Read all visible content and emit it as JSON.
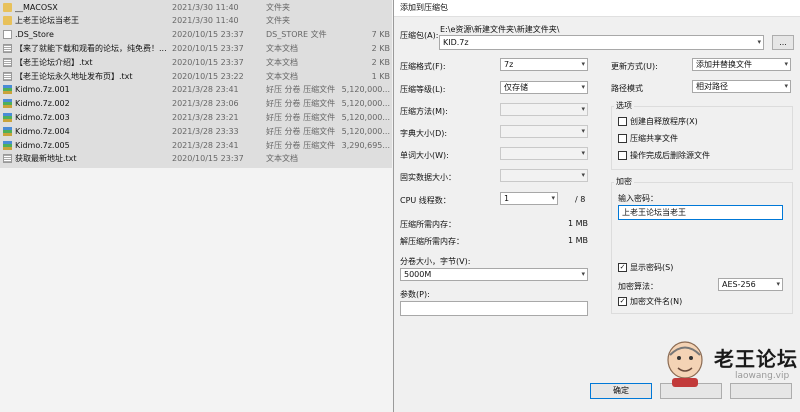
{
  "files": [
    {
      "name": "__MACOSX",
      "date": "2021/3/30 11:40",
      "type": "文件夹",
      "size": "",
      "icon": "folder-icon"
    },
    {
      "name": "上老王论坛当老王",
      "date": "2021/3/30 11:40",
      "type": "文件夹",
      "size": "",
      "icon": "folder-icon"
    },
    {
      "name": ".DS_Store",
      "date": "2020/10/15 23:37",
      "type": "DS_STORE 文件",
      "size": "7 KB",
      "icon": "file-icon"
    },
    {
      "name": "【来了就能下载和观看的论坛，纯免费！...",
      "date": "2020/10/15 23:37",
      "type": "文本文档",
      "size": "2 KB",
      "icon": "text-file-icon"
    },
    {
      "name": "【老王论坛介绍】.txt",
      "date": "2020/10/15 23:37",
      "type": "文本文档",
      "size": "2 KB",
      "icon": "text-file-icon"
    },
    {
      "name": "【老王论坛永久地址发布页】.txt",
      "date": "2020/10/15 23:22",
      "type": "文本文档",
      "size": "1 KB",
      "icon": "text-file-icon"
    },
    {
      "name": "Kidmo.7z.001",
      "date": "2021/3/28 23:41",
      "type": "好压 分卷 压缩文件",
      "size": "5,120,000...",
      "icon": "archive-icon"
    },
    {
      "name": "Kidmo.7z.002",
      "date": "2021/3/28 23:06",
      "type": "好压 分卷 压缩文件",
      "size": "5,120,000...",
      "icon": "archive-icon"
    },
    {
      "name": "Kidmo.7z.003",
      "date": "2021/3/28 23:21",
      "type": "好压 分卷 压缩文件",
      "size": "5,120,000...",
      "icon": "archive-icon"
    },
    {
      "name": "Kidmo.7z.004",
      "date": "2021/3/28 23:33",
      "type": "好压 分卷 压缩文件",
      "size": "5,120,000...",
      "icon": "archive-icon"
    },
    {
      "name": "Kidmo.7z.005",
      "date": "2021/3/28 23:41",
      "type": "好压 分卷 压缩文件",
      "size": "3,290,695...",
      "icon": "archive-icon"
    },
    {
      "name": "获取最新地址.txt",
      "date": "2020/10/15 23:37",
      "type": "文本文档",
      "size": "",
      "icon": "text-file-icon"
    }
  ],
  "dialog": {
    "title": "添加到压缩包",
    "archive_label": "压缩包(A):",
    "archive_path": "E:\\e资源\\新建文件夹\\新建文件夹\\",
    "archive_name": "KID.7z",
    "browse_label": "...",
    "format_label": "压缩格式(F):",
    "format_value": "7z",
    "level_label": "压缩等级(L):",
    "level_value": "仅存储",
    "method_label": "压缩方法(M):",
    "dict_label": "字典大小(D):",
    "word_label": "单词大小(W):",
    "solid_label": "固实数据大小：",
    "cpu_label": "CPU 线程数：",
    "cpu_value": "1",
    "cpu_total": "/ 8",
    "mem_compress_label": "压缩所需内存：",
    "mem_compress_value": "1 MB",
    "mem_decompress_label": "解压缩所需内存：",
    "mem_decompress_value": "1 MB",
    "volume_label": "分卷大小，字节(V):",
    "volume_value": "5000M",
    "params_label": "参数(P):",
    "params_value": "",
    "update_label": "更新方式(U):",
    "update_value": "添加并替换文件",
    "path_mode_label": "路径模式",
    "path_mode_value": "相对路径",
    "options_title": "选项",
    "opt_sfx": "创建自释放程序(X)",
    "opt_shared": "压缩共享文件",
    "opt_delete": "操作完成后删除源文件",
    "encrypt_title": "加密",
    "password_label": "输入密码：",
    "password_value": "上老王论坛当老王",
    "show_password": "显示密码(S)",
    "enc_method_label": "加密算法：",
    "enc_method_value": "AES-256",
    "encrypt_names": "加密文件名(N)",
    "ok_label": "确定",
    "cancel_label": "",
    "help_label": ""
  },
  "watermark": {
    "title": "老王论坛",
    "url": "laowang.vip"
  }
}
